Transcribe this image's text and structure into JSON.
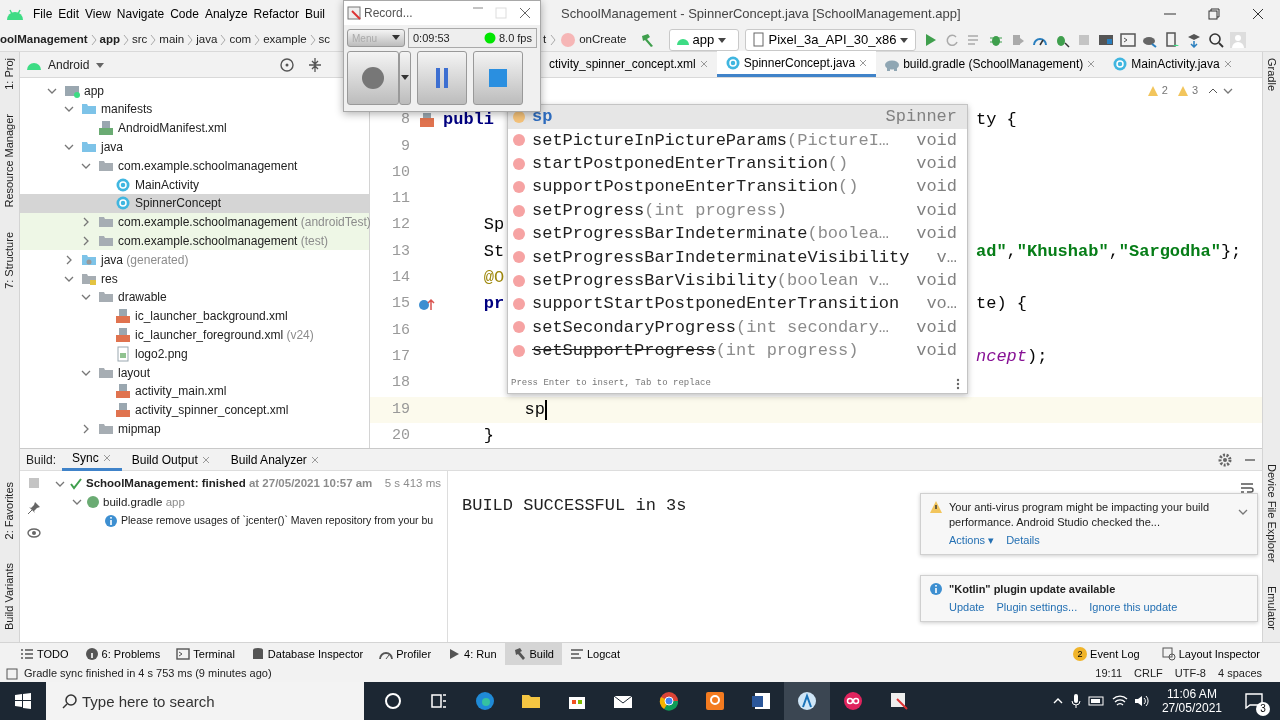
{
  "menu": [
    "File",
    "Edit",
    "View",
    "Navigate",
    "Code",
    "Analyze",
    "Refactor",
    "Buil"
  ],
  "window": {
    "title": "SchoolManagement - SpinnerConcept.java [SchoolManagement.app]"
  },
  "breadcrumbs": [
    "oolManagement",
    "app",
    "src",
    "main",
    "java",
    "com",
    "example",
    "sc"
  ],
  "method_crumb": {
    "prefix": "t",
    "label": "onCreate"
  },
  "run_config": {
    "module": "app",
    "device": "Pixel_3a_API_30_x86"
  },
  "recorder": {
    "title": "Record...",
    "menu": "Menu",
    "menu_disabled": true,
    "time": "0:09:53",
    "fps": "8.0 fps"
  },
  "project_panel": {
    "view": "Android",
    "tree": [
      {
        "label": "app",
        "kind": "module",
        "expanded": true,
        "selected": false,
        "children": [
          {
            "label": "manifests",
            "kind": "folder",
            "expanded": true,
            "selected": false,
            "children": [
              {
                "label": "AndroidManifest.xml",
                "kind": "manifest",
                "selected": false
              }
            ]
          },
          {
            "label": "java",
            "kind": "folder",
            "expanded": true,
            "selected": false,
            "children": [
              {
                "label": "com.example.schoolmanagement",
                "kind": "package",
                "expanded": true,
                "selected": false,
                "children": [
                  {
                    "label": "MainActivity",
                    "kind": "class",
                    "selected": false
                  },
                  {
                    "label": "SpinnerConcept",
                    "kind": "class",
                    "selected": true
                  }
                ]
              },
              {
                "label": "com.example.schoolmanagement",
                "suffix": "(androidTest)",
                "kind": "package",
                "expanded": false,
                "selected": false,
                "test": true
              },
              {
                "label": "com.example.schoolmanagement",
                "suffix": "(test)",
                "kind": "package",
                "expanded": false,
                "selected": false,
                "test": true
              }
            ]
          },
          {
            "label": "java",
            "suffix": "(generated)",
            "kind": "generated",
            "expanded": false,
            "selected": false
          },
          {
            "label": "res",
            "kind": "res",
            "expanded": true,
            "selected": false,
            "children": [
              {
                "label": "drawable",
                "kind": "package",
                "expanded": true,
                "selected": false,
                "children": [
                  {
                    "label": "ic_launcher_background.xml",
                    "kind": "xml",
                    "selected": false
                  },
                  {
                    "label": "ic_launcher_foreground.xml",
                    "suffix": "(v24)",
                    "kind": "xml",
                    "selected": false
                  },
                  {
                    "label": "logo2.png",
                    "kind": "image",
                    "selected": false
                  }
                ]
              },
              {
                "label": "layout",
                "kind": "package",
                "expanded": true,
                "selected": false,
                "children": [
                  {
                    "label": "activity_main.xml",
                    "kind": "xml",
                    "selected": false
                  },
                  {
                    "label": "activity_spinner_concept.xml",
                    "kind": "xml",
                    "selected": false
                  }
                ]
              },
              {
                "label": "mipmap",
                "kind": "package",
                "expanded": false,
                "selected": false
              }
            ]
          }
        ]
      }
    ]
  },
  "editor_tabs": [
    {
      "label": "ctivity_spinner_concept.xml",
      "kind": "xml",
      "selected": false
    },
    {
      "label": "SpinnerConcept.java",
      "kind": "class",
      "selected": true
    },
    {
      "label": "build.gradle (SchoolManagement)",
      "kind": "gradle",
      "selected": false
    },
    {
      "label": "MainActivity.java",
      "kind": "class",
      "selected": false
    }
  ],
  "inspections": {
    "warnings": "2",
    "weak_warnings": "3"
  },
  "code_lines": [
    {
      "number": "8",
      "kind": "layout",
      "left": [
        {
          "text": "publi",
          "kind": "keyword"
        }
      ],
      "right": [
        {
          "text": "ty {",
          "kind": "plain"
        }
      ]
    },
    {
      "number": "9"
    },
    {
      "number": "10"
    },
    {
      "number": "11"
    },
    {
      "number": "12",
      "left": [
        {
          "text": "    Sp",
          "kind": "plain"
        }
      ]
    },
    {
      "number": "13",
      "left": [
        {
          "text": "    St",
          "kind": "plain"
        }
      ],
      "right": [
        {
          "text": "ad\"",
          "kind": "string"
        },
        {
          "text": ",",
          "kind": "plain"
        },
        {
          "text": "\"Khushab\"",
          "kind": "string"
        },
        {
          "text": ",",
          "kind": "plain"
        },
        {
          "text": "\"Sargodha\"",
          "kind": "string"
        },
        {
          "text": "};",
          "kind": "plain"
        }
      ]
    },
    {
      "number": "14",
      "left": [
        {
          "text": "    @O",
          "kind": "annotation"
        }
      ]
    },
    {
      "number": "15",
      "kind": "override",
      "left": [
        {
          "text": "    pr",
          "kind": "keyword"
        }
      ],
      "right": [
        {
          "text": "te) {",
          "kind": "plain"
        }
      ]
    },
    {
      "number": "16"
    },
    {
      "number": "17",
      "right": [
        {
          "text": "ncept",
          "kind": "field"
        },
        {
          "text": ");",
          "kind": "plain"
        }
      ]
    },
    {
      "number": "18"
    },
    {
      "number": "19",
      "current": true,
      "left": [
        {
          "text": "        sp",
          "kind": "plain"
        }
      ]
    },
    {
      "number": "20",
      "left": [
        {
          "text": "    }",
          "kind": "plain"
        }
      ]
    }
  ],
  "completion": {
    "items": [
      {
        "kind": "field",
        "name": "sp",
        "type": "Spinner",
        "selected": true,
        "deprecated": false
      },
      {
        "kind": "method",
        "name": "setPictureInPictureParams",
        "params": "(PictureI…",
        "type": "void",
        "selected": false,
        "deprecated": false
      },
      {
        "kind": "method",
        "name": "startPostponedEnterTransition",
        "params": "()",
        "type": "void",
        "selected": false,
        "deprecated": false
      },
      {
        "kind": "method",
        "name": "supportPostponeEnterTransition",
        "params": "()",
        "type": "void",
        "selected": false,
        "deprecated": false
      },
      {
        "kind": "method",
        "name": "setProgress",
        "params": "(int progress)",
        "type": "void",
        "selected": false,
        "deprecated": false
      },
      {
        "kind": "method",
        "name": "setProgressBarIndeterminate",
        "params": "(boolea…",
        "type": "void",
        "selected": false,
        "deprecated": false
      },
      {
        "kind": "method",
        "name": "setProgressBarIndeterminateVisibility",
        "type": "v…",
        "selected": false,
        "deprecated": false
      },
      {
        "kind": "method",
        "name": "setProgressBarVisibility",
        "params": "(boolean v…",
        "type": "void",
        "selected": false,
        "deprecated": false
      },
      {
        "kind": "method",
        "name": "supportStartPostponedEnterTransition",
        "type": "vo…",
        "selected": false,
        "deprecated": false
      },
      {
        "kind": "method",
        "name": "setSecondaryProgress",
        "params": "(int secondary…",
        "type": "void",
        "selected": false,
        "deprecated": false
      },
      {
        "kind": "method",
        "name": "setSupportProgress",
        "params": "(int progress)",
        "type": "void",
        "selected": false,
        "deprecated": true
      }
    ],
    "hint": "Press Enter to insert, Tab to replace"
  },
  "left_strip_top": [
    "1: Proj",
    "Resource Manager",
    "7: Structure"
  ],
  "left_strip_bottom": [
    "2: Favorites",
    "Build Variants"
  ],
  "right_strip_top": [
    "Gradle"
  ],
  "right_strip_bottom": [
    "Device File Explorer",
    "Emulator"
  ],
  "build_panel": {
    "label": "Build:",
    "tabs": [
      {
        "label": "Sync",
        "selected": true
      },
      {
        "label": "Build Output",
        "selected": false
      },
      {
        "label": "Build Analyzer",
        "selected": false
      }
    ],
    "tree": [
      {
        "kind": "success",
        "label": "SchoolManagement: finished",
        "detail": "at 27/05/2021 10:57 am",
        "time": "5 s 413 ms",
        "expanded": true,
        "children": [
          {
            "kind": "gradle",
            "label": "build.gradle",
            "detail": "app",
            "expanded": true,
            "children": [
              {
                "kind": "info",
                "label": "Please remove usages of `jcenter()` Maven repository from your bu"
              }
            ]
          }
        ]
      }
    ],
    "console": "BUILD SUCCESSFUL in 3s"
  },
  "notifications": [
    {
      "kind": "warning",
      "text": "Your anti-virus program might be impacting your build performance. Android Studio checked the...",
      "actions": [
        "Actions ▾",
        "Details"
      ]
    },
    {
      "kind": "info",
      "text": "\"Kotlin\" plugin update available",
      "actions": [
        "Update",
        "Plugin settings...",
        "Ignore this update"
      ]
    }
  ],
  "tool_windows": [
    {
      "label": "TODO",
      "kind": "list",
      "selected": false
    },
    {
      "label": "6: Problems",
      "kind": "info",
      "selected": false
    },
    {
      "label": "Terminal",
      "kind": "terminal",
      "selected": false
    },
    {
      "label": "Database Inspector",
      "kind": "database",
      "selected": false
    },
    {
      "label": "Profiler",
      "kind": "gauge",
      "selected": false
    },
    {
      "label": "4: Run",
      "kind": "play",
      "selected": false
    },
    {
      "label": "Build",
      "kind": "hammer",
      "selected": true
    },
    {
      "label": "Logcat",
      "kind": "lines",
      "selected": false
    }
  ],
  "right_tools": [
    {
      "label": "Event Log",
      "badge": "2"
    },
    {
      "label": "Layout Inspector"
    }
  ],
  "status_bar": {
    "message": "Gradle sync finished in 4 s 753 ms (9 minutes ago)",
    "items": [
      "19:11",
      "CRLF",
      "UTF-8",
      "4 spaces"
    ]
  },
  "taskbar": {
    "search_placeholder": "Type here to search",
    "time": "11:06 AM",
    "date": "27/05/2021",
    "notifications": "3"
  }
}
